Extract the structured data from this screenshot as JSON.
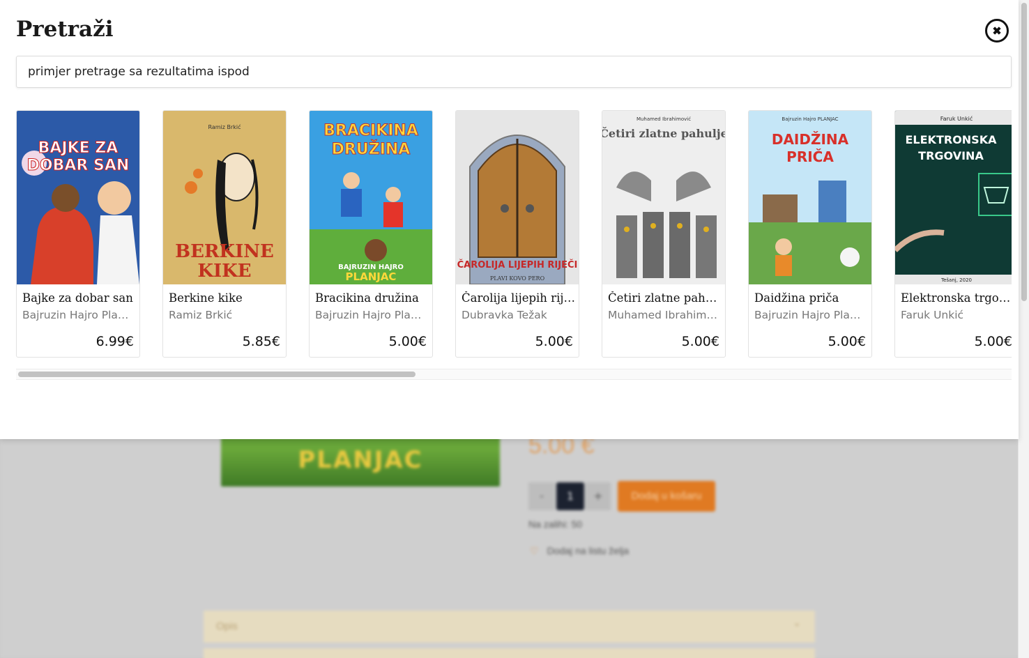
{
  "modal": {
    "title": "Pretraži",
    "close_icon": "close-circle-icon"
  },
  "search": {
    "value": "primjer pretrage sa rezultatima ispod"
  },
  "results": [
    {
      "title": "Bajke za dobar san",
      "author": "Bajruzin Hajro Planjac",
      "price": "6.99€",
      "cover_text": "BAJKE ZA DOBAR SAN",
      "cover_colors": [
        "#2b5fae",
        "#e24b2a"
      ]
    },
    {
      "title": "Berkine kike",
      "author": "Ramiz Brkić",
      "price": "5.85€",
      "cover_text": "BERKINE KIKE",
      "cover_colors": [
        "#d9b86c",
        "#b5331f"
      ]
    },
    {
      "title": "Bracikina družina",
      "author": "Bajruzin Hajro Planjac",
      "price": "5.00€",
      "cover_text": "BRACIKINA DRUŽINA",
      "cover_colors": [
        "#3a9ee0",
        "#5fae3c"
      ]
    },
    {
      "title": "Čarolija lijepih riječi",
      "author": "Dubravka Težak",
      "price": "5.00€",
      "cover_text": "ČAROLIJA LIJEPIH RIJEČI",
      "cover_colors": [
        "#d8d8d8",
        "#b07a3a"
      ]
    },
    {
      "title": "Četiri zlatne pahulje",
      "author": "Muhamed Ibrahimović",
      "price": "5.00€",
      "cover_text": "Četiri zlatne pahulje",
      "cover_colors": [
        "#e8e8e8",
        "#6a6a6a"
      ]
    },
    {
      "title": "Daidžina priča",
      "author": "Bajruzin Hajro Planjac",
      "price": "5.00€",
      "cover_text": "DAIDŽINA PRIČA",
      "cover_colors": [
        "#bfe3f5",
        "#6aa84a"
      ]
    },
    {
      "title": "Elektronska trgovina",
      "author": "Faruk Unkić",
      "price": "5.00€",
      "cover_text": "ELEKTRONSKA TRGOVINA",
      "cover_colors": [
        "#0f3a34",
        "#39c98a"
      ]
    }
  ],
  "background": {
    "cover_text": "PLANJAC",
    "price": "5.00 €",
    "qty": "1",
    "minus": "-",
    "plus": "+",
    "add_to_cart": "Dodaj u košaru",
    "stock": "Na zalihi: 50",
    "wishlist": "Dodaj na listu želja",
    "tab_label": "Opis"
  }
}
